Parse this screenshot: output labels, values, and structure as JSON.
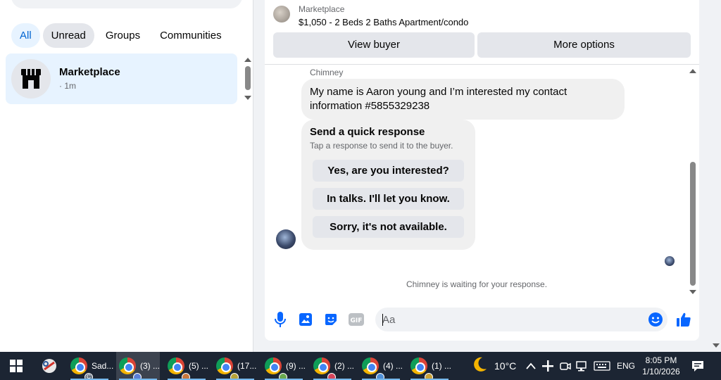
{
  "sidebar": {
    "filters": [
      {
        "label": "All"
      },
      {
        "label": "Unread"
      },
      {
        "label": "Groups"
      },
      {
        "label": "Communities"
      }
    ],
    "conversation": {
      "name": "Marketplace",
      "time": "· 1m",
      "icon": "storefront-icon"
    }
  },
  "chat": {
    "listing": {
      "source": "Marketplace",
      "title": "$1,050 - 2 Beds 2 Baths Apartment/condo"
    },
    "header_buttons": {
      "view_buyer": "View buyer",
      "more_options": "More options"
    },
    "sender": "Chimney",
    "message": "My name is Aaron young and I’m interested my contact information #5855329238",
    "quick_response": {
      "title": "Send a quick response",
      "subtitle": "Tap a response to send it to the buyer.",
      "options": [
        "Yes, are you interested?",
        "In talks. I'll let you know.",
        "Sorry, it's not available."
      ]
    },
    "waiting_text": "Chimney is waiting for your response.",
    "composer": {
      "placeholder": "Aa",
      "icons": [
        "microphone-icon",
        "image-icon",
        "sticker-icon",
        "gif-icon",
        "emoji-icon",
        "thumbs-up-icon"
      ]
    }
  },
  "colors": {
    "accent": "#0866ff",
    "selected_bg": "#e7f3ff",
    "taskbar": "#1c2533"
  },
  "taskbar": {
    "apps": [
      {
        "label": "Sad..."
      },
      {
        "label": "(3) ..."
      },
      {
        "label": "(5) ..."
      },
      {
        "label": "(17..."
      },
      {
        "label": "(9) ..."
      },
      {
        "label": "(2) ..."
      },
      {
        "label": "(4) ..."
      },
      {
        "label": "(1) ..."
      }
    ],
    "weather": "10°C",
    "language": "ENG",
    "time": "8:05 PM",
    "date": "1/10/2026"
  }
}
